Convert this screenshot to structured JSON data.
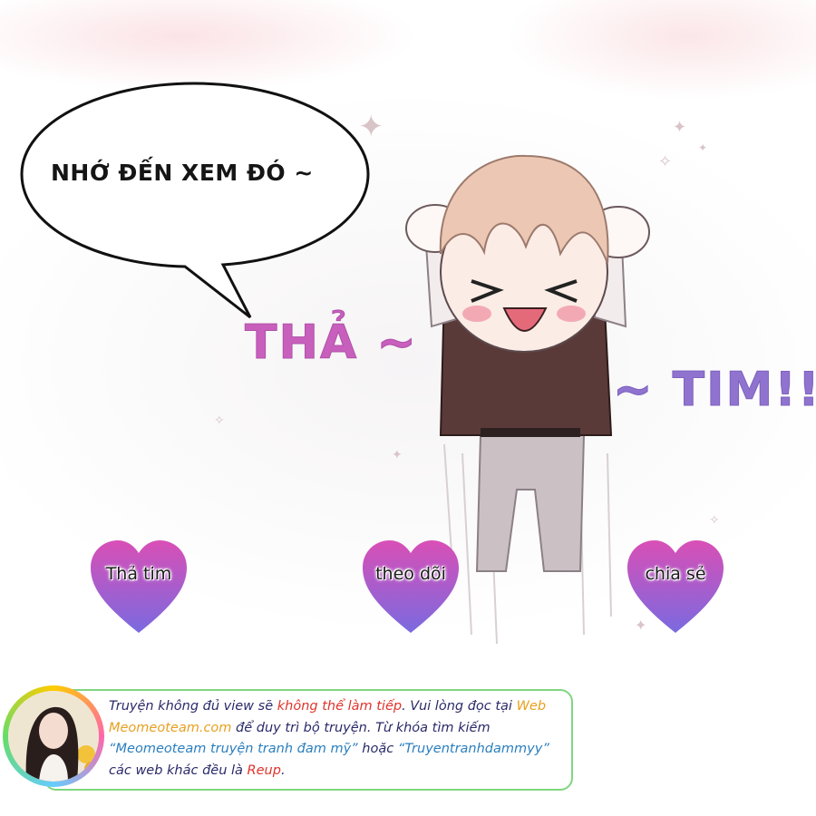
{
  "bubble": {
    "text": "NHỚ ĐẾN XEM ĐÓ ~"
  },
  "title_left": "THẢ ~",
  "title_right": "~ TIM!!",
  "buttons": [
    {
      "label": "Thả tim"
    },
    {
      "label": "theo dõi"
    },
    {
      "label": "chia sẻ"
    }
  ],
  "footer": {
    "part1": "Truyện không đủ view sẽ ",
    "part2": "không thể làm tiếp",
    "part3": ". Vui lòng đọc tại ",
    "part4": "Web Meomeoteam.com",
    "part5": " để duy trì bộ truyện. Từ khóa tìm kiếm ",
    "part6": "“Meomeoteam truyện tranh đam mỹ”",
    "part7": " hoặc ",
    "part8": "“Truyentranhdammyy”",
    "part9": " các web khác đều là ",
    "part10": "Reup",
    "part11": "."
  },
  "colors": {
    "heart_top": "#d94fb6",
    "heart_bottom": "#7a6ae0",
    "title_pink": "#c85fbd",
    "title_purple": "#8f73cf",
    "footer_border": "#7fd67f"
  }
}
